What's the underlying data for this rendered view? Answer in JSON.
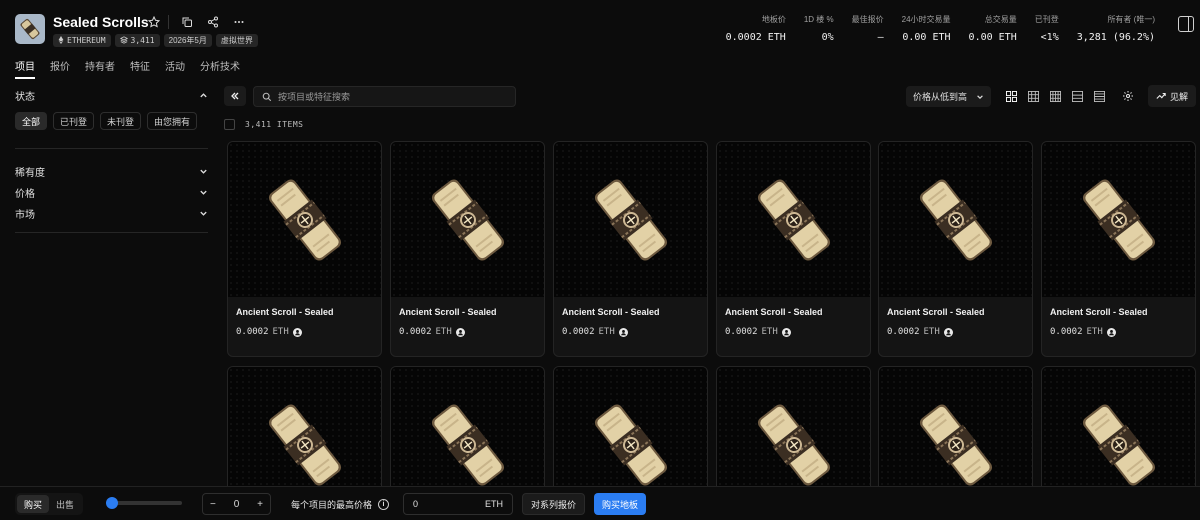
{
  "collection": {
    "name": "Sealed Scrolls",
    "chips": [
      {
        "icon": "ethereum-icon",
        "label": "ETHEREUM"
      },
      {
        "icon": "layers-icon",
        "label": "3,411"
      },
      {
        "icon": "",
        "label": "2026年5月"
      },
      {
        "icon": "",
        "label": "虚拟世界"
      }
    ]
  },
  "stats": [
    {
      "label": "地板价",
      "value": "0.0002 ETH"
    },
    {
      "label": "1D 楼 %",
      "value": "0%"
    },
    {
      "label": "最佳报价",
      "value": "–"
    },
    {
      "label": "24小时交易量",
      "value": "0.00 ETH"
    },
    {
      "label": "总交易量",
      "value": "0.00 ETH"
    },
    {
      "label": "已刊登",
      "value": "<1%"
    },
    {
      "label": "所有者 (唯一)",
      "value": "3,281 (96.2%)"
    }
  ],
  "tabs": [
    "项目",
    "报价",
    "持有者",
    "特征",
    "活动",
    "分析技术"
  ],
  "sidebar": {
    "status_label": "状态",
    "status_buttons": [
      "全部",
      "已刊登",
      "未刊登",
      "由您拥有"
    ],
    "filters": [
      "稀有度",
      "价格",
      "市场"
    ]
  },
  "toolbar": {
    "search_placeholder": "按项目或特征搜索",
    "sort_label": "价格从低到高",
    "insight_label": "见解"
  },
  "items_count": "3,411 ITEMS",
  "items": [
    {
      "name": "Ancient Scroll - Sealed",
      "price": "0.0002",
      "unit": "ETH"
    },
    {
      "name": "Ancient Scroll - Sealed",
      "price": "0.0002",
      "unit": "ETH"
    },
    {
      "name": "Ancient Scroll - Sealed",
      "price": "0.0002",
      "unit": "ETH"
    },
    {
      "name": "Ancient Scroll - Sealed",
      "price": "0.0002",
      "unit": "ETH"
    },
    {
      "name": "Ancient Scroll - Sealed",
      "price": "0.0002",
      "unit": "ETH"
    },
    {
      "name": "Ancient Scroll - Sealed",
      "price": "0.0002",
      "unit": "ETH"
    },
    {
      "name": "",
      "price": "",
      "unit": ""
    },
    {
      "name": "",
      "price": "",
      "unit": ""
    },
    {
      "name": "",
      "price": "",
      "unit": ""
    },
    {
      "name": "",
      "price": "",
      "unit": ""
    },
    {
      "name": "",
      "price": "",
      "unit": ""
    },
    {
      "name": "",
      "price": "",
      "unit": ""
    }
  ],
  "footer": {
    "buy": "购买",
    "sell": "出售",
    "quantity": "0",
    "max_price_label": "每个项目的最高价格",
    "max_price_value": "0",
    "max_price_unit": "ETH",
    "collection_offer": "对系列报价",
    "buy_floor": "购买地板"
  }
}
